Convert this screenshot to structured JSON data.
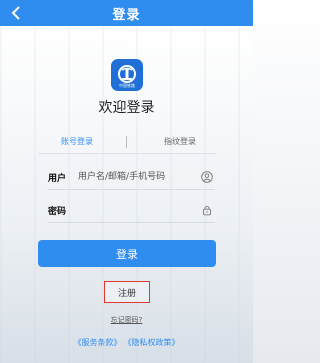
{
  "header": {
    "title": "登录",
    "back_icon": "chevron-left-icon"
  },
  "logo": {
    "caption": "中国铁路",
    "color": "#1f6fd6"
  },
  "welcome": "欢迎登录",
  "tabs": [
    {
      "label": "账号登录",
      "active": true
    },
    {
      "label": "指纹登录",
      "active": false
    }
  ],
  "form": {
    "username": {
      "label": "用户",
      "placeholder": "用户名/邮箱/手机号码",
      "icon": "user-icon"
    },
    "password": {
      "label": "密码",
      "placeholder": "",
      "icon": "lock-icon"
    }
  },
  "login_button": "登录",
  "register": "注册",
  "forgot": "忘记密码?",
  "policies": {
    "terms": "《服务条款》",
    "privacy": "《隐私权政策》"
  },
  "colors": {
    "accent": "#2f8df0",
    "highlight": "#e03a2e"
  }
}
